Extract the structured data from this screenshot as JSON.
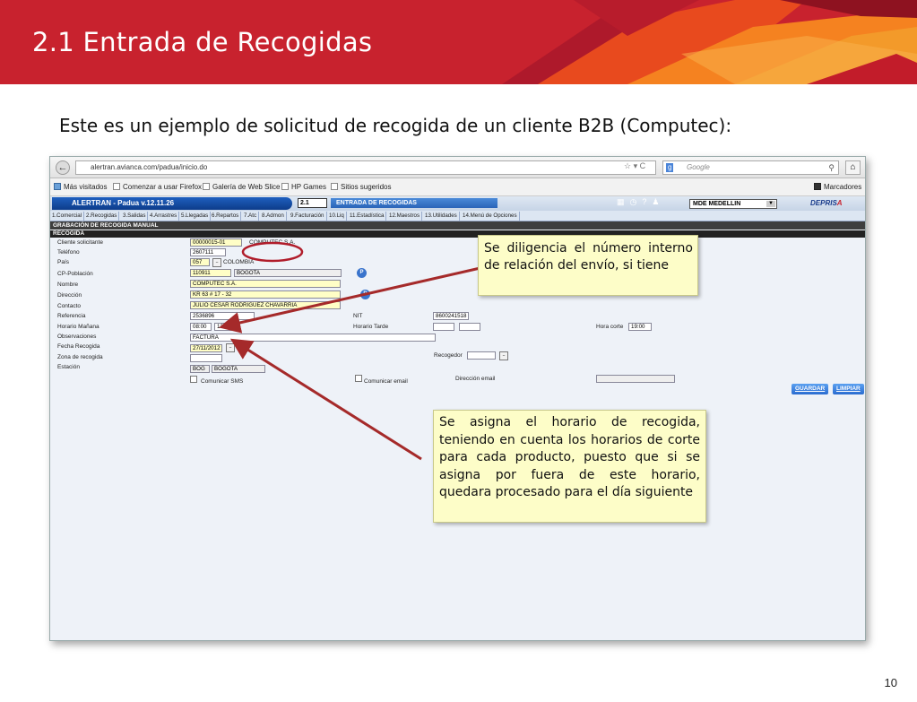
{
  "slide": {
    "title": "2.1 Entrada de Recogidas",
    "intro": "Este es un ejemplo de solicitud de recogida de un cliente B2B (Computec):",
    "page_number": "10"
  },
  "colors": {
    "brand_red": "#c8222e",
    "callout_bg": "#fdfdc8",
    "arrow": "#a52a2a"
  },
  "browser": {
    "url": "alertran.avianca.com/padua/inicio.do",
    "search_placeholder": "Google",
    "bookmarks": [
      "Más visitados",
      "Comenzar a usar Firefox",
      "Galería de Web Slice",
      "HP Games",
      "Sitios sugeridos"
    ],
    "bookmarks_right": "Marcadores"
  },
  "app": {
    "name": "ALERTRAN - Padua  v.12.11.26",
    "module_number": "2.1",
    "module_name": "ENTRADA DE RECOGIDAS",
    "office": "MDE MEDELLIN",
    "logo": "DEPRISA",
    "tabs": [
      "1.Comercial",
      "2.Recogidas",
      "3.Salidas",
      "4.Arrastres",
      "5.Llegadas",
      "6.Repartos",
      "7.Atc",
      "8.Admon",
      "9.Facturación",
      "10.Liq",
      "11.Estadística",
      "12.Maestros",
      "13.Utilidades",
      "14.Menú de Opciones"
    ],
    "section_title": "GRABACIÓN DE RECOGIDA MANUAL",
    "subsection_title": "RECOGIDA"
  },
  "form": {
    "labels": {
      "cliente": "Cliente solicitante",
      "telefono": "Teléfono",
      "pais": "País",
      "cp": "CP-Población",
      "nombre": "Nombre",
      "direccion": "Dirección",
      "contacto": "Contacto",
      "referencia": "Referencia",
      "horario_manana": "Horario Mañana",
      "observaciones": "Observaciones",
      "fecha": "Fecha Recogida",
      "zona": "Zona de recogida",
      "estacion": "Estación",
      "nit": "NIT",
      "horario_tarde": "Horario Tarde",
      "hora_corte": "Hora corte",
      "recogedor": "Recogedor",
      "comunicar_sms": "Comunicar SMS",
      "comunicar_email": "Comunicar email",
      "direccion_email": "Dirección email"
    },
    "values": {
      "cliente_code": "00000015-01",
      "cliente_name": "COMPUTEC S.A.",
      "telefono": "2607111",
      "pais_code": "057",
      "pais_name": "COLOMBIA",
      "cp_code": "110911",
      "cp_name": "BOGOTA",
      "nombre": "COMPUTEC S.A.",
      "direccion": "KR 63 # 17 - 32",
      "contacto": "JULIO CESAR RODRIGUEZ CHAVARRIA",
      "referencia": "2536896",
      "horario_manana_desde": "08:00",
      "horario_manana_hasta": "12:00",
      "observaciones": "FACTURA",
      "fecha": "27/11/2012",
      "estacion_code": "BOG",
      "estacion_name": "BOGOTA",
      "nit": "8600241518",
      "hora_corte": "19:00"
    },
    "buttons": {
      "guardar": "GUARDAR",
      "limpiar": "LIMPIAR"
    }
  },
  "callouts": {
    "first": "Se diligencia el número interno de relación del envío, si tiene",
    "second": "Se asigna el horario de recogida, teniendo en cuenta los horarios de corte para cada producto, puesto que si se asigna por fuera de este horario, quedara procesado para el día siguiente"
  }
}
